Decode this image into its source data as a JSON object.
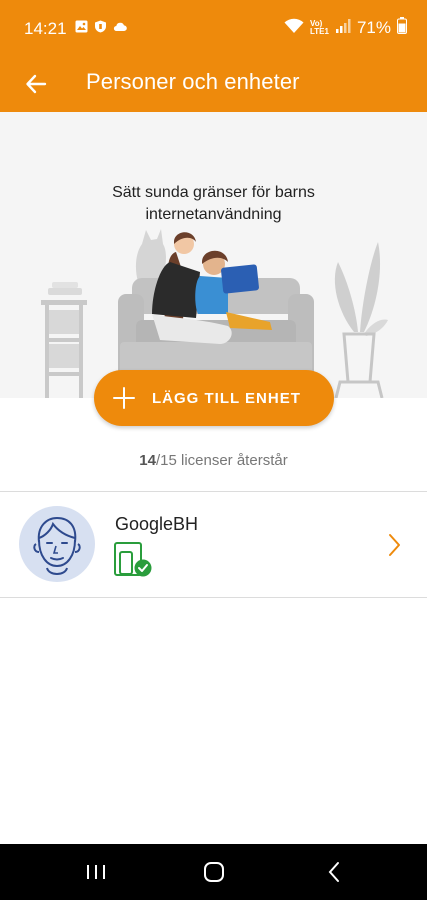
{
  "status_bar": {
    "time": "14:21",
    "battery": "71%",
    "network_label_1": "Vo)",
    "network_label_2": "LTE1"
  },
  "app_bar": {
    "title": "Personer och enheter",
    "back_icon": "arrow-left-icon"
  },
  "hero": {
    "line1": "Sätt sunda gränser för barns",
    "line2": "internetanvändning"
  },
  "add_button": {
    "label": "LÄGG TILL ENHET",
    "icon": "plus-icon"
  },
  "licenses": {
    "used": "14",
    "text": "/15 licenser återstår"
  },
  "people": [
    {
      "name": "GoogleBH",
      "device_icon": "device-protected-icon",
      "status_color": "#2a9d3c"
    }
  ],
  "colors": {
    "accent": "#ee8a0c",
    "hero_bg": "#f5f5f5",
    "avatar_bg": "#d7e0f1",
    "avatar_line": "#2e4a8e",
    "protected_green": "#2a9d3c"
  }
}
